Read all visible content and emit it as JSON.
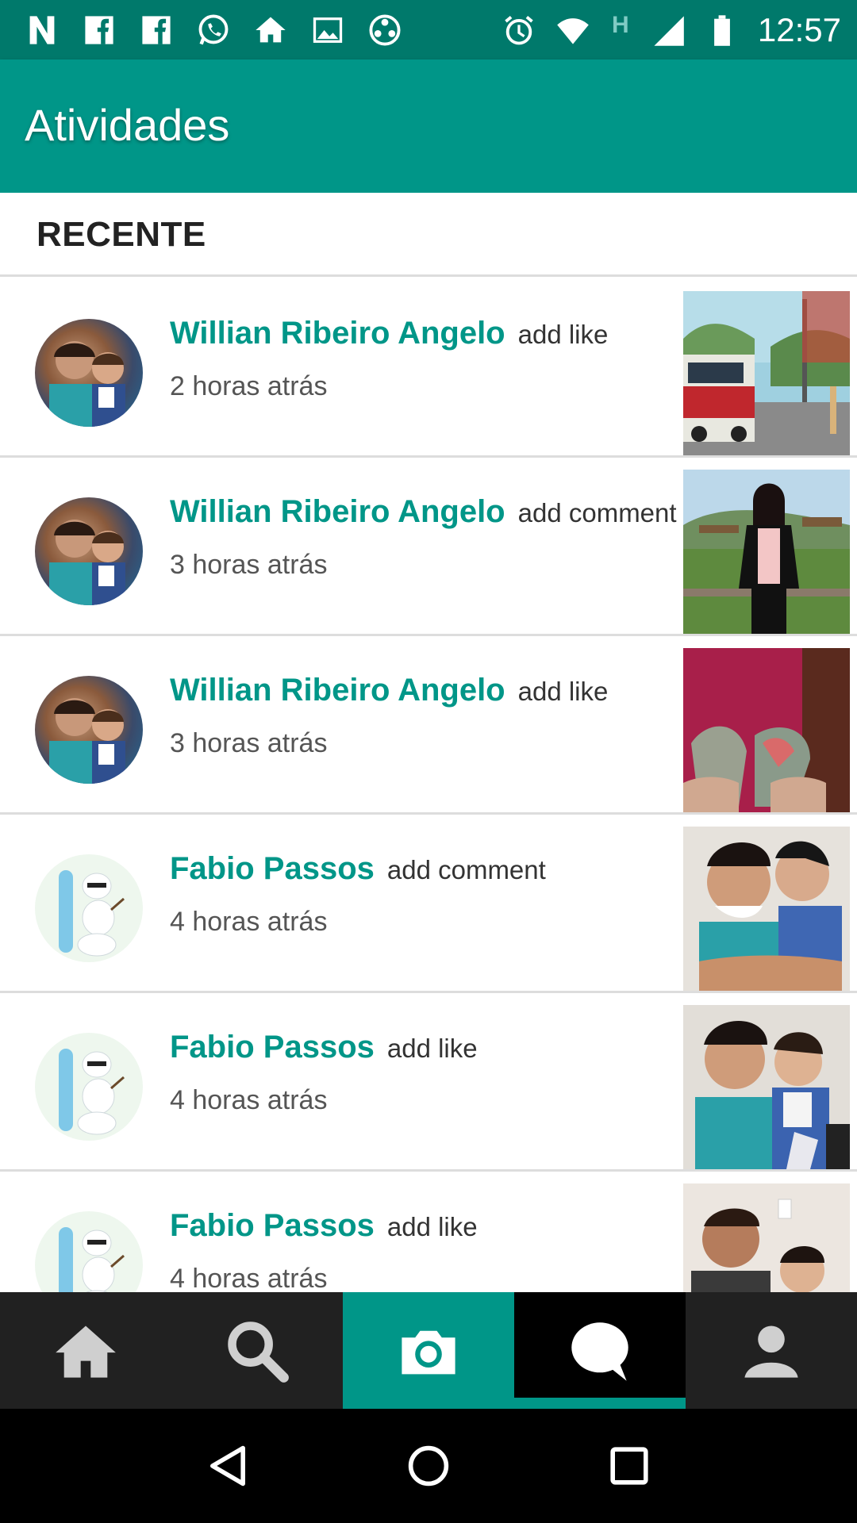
{
  "status_bar": {
    "left_icons": [
      "n-icon",
      "facebook-icon",
      "facebook-icon",
      "whatsapp-icon",
      "home-icon",
      "image-icon",
      "film-reel-icon"
    ],
    "right_icons": [
      "alarm-icon",
      "wifi-icon",
      "h-network-icon",
      "signal-icon",
      "battery-icon"
    ],
    "network_letter": "H",
    "time": "12:57"
  },
  "app_bar": {
    "title": "Atividades"
  },
  "section": {
    "title": "RECENTE"
  },
  "feed": [
    {
      "name": "Willian Ribeiro Angelo",
      "action": "add like",
      "time": "2 horas atrás",
      "avatar": "person",
      "thumb": "street"
    },
    {
      "name": "Willian Ribeiro Angelo",
      "action": "add comment",
      "time": "3 horas atrás",
      "avatar": "person",
      "thumb": "park"
    },
    {
      "name": "Willian Ribeiro Angelo",
      "action": "add like",
      "time": "3 horas atrás",
      "avatar": "person",
      "thumb": "hands"
    },
    {
      "name": "Fabio Passos",
      "action": "add comment",
      "time": "4 horas atrás",
      "avatar": "olaf",
      "thumb": "kiss"
    },
    {
      "name": "Fabio Passos",
      "action": "add like",
      "time": "4 horas atrás",
      "avatar": "olaf",
      "thumb": "selfie"
    },
    {
      "name": "Fabio Passos",
      "action": "add like",
      "time": "4 horas atrás",
      "avatar": "olaf",
      "thumb": "man-child"
    }
  ],
  "bottom_nav": [
    {
      "icon": "home-icon",
      "active": false
    },
    {
      "icon": "search-icon",
      "active": false
    },
    {
      "icon": "camera-icon",
      "active": false
    },
    {
      "icon": "chat-icon",
      "active": true
    },
    {
      "icon": "profile-icon",
      "active": false
    }
  ],
  "colors": {
    "primary": "#009688",
    "primary_dark": "#00796b",
    "nav_bg": "#212121"
  }
}
